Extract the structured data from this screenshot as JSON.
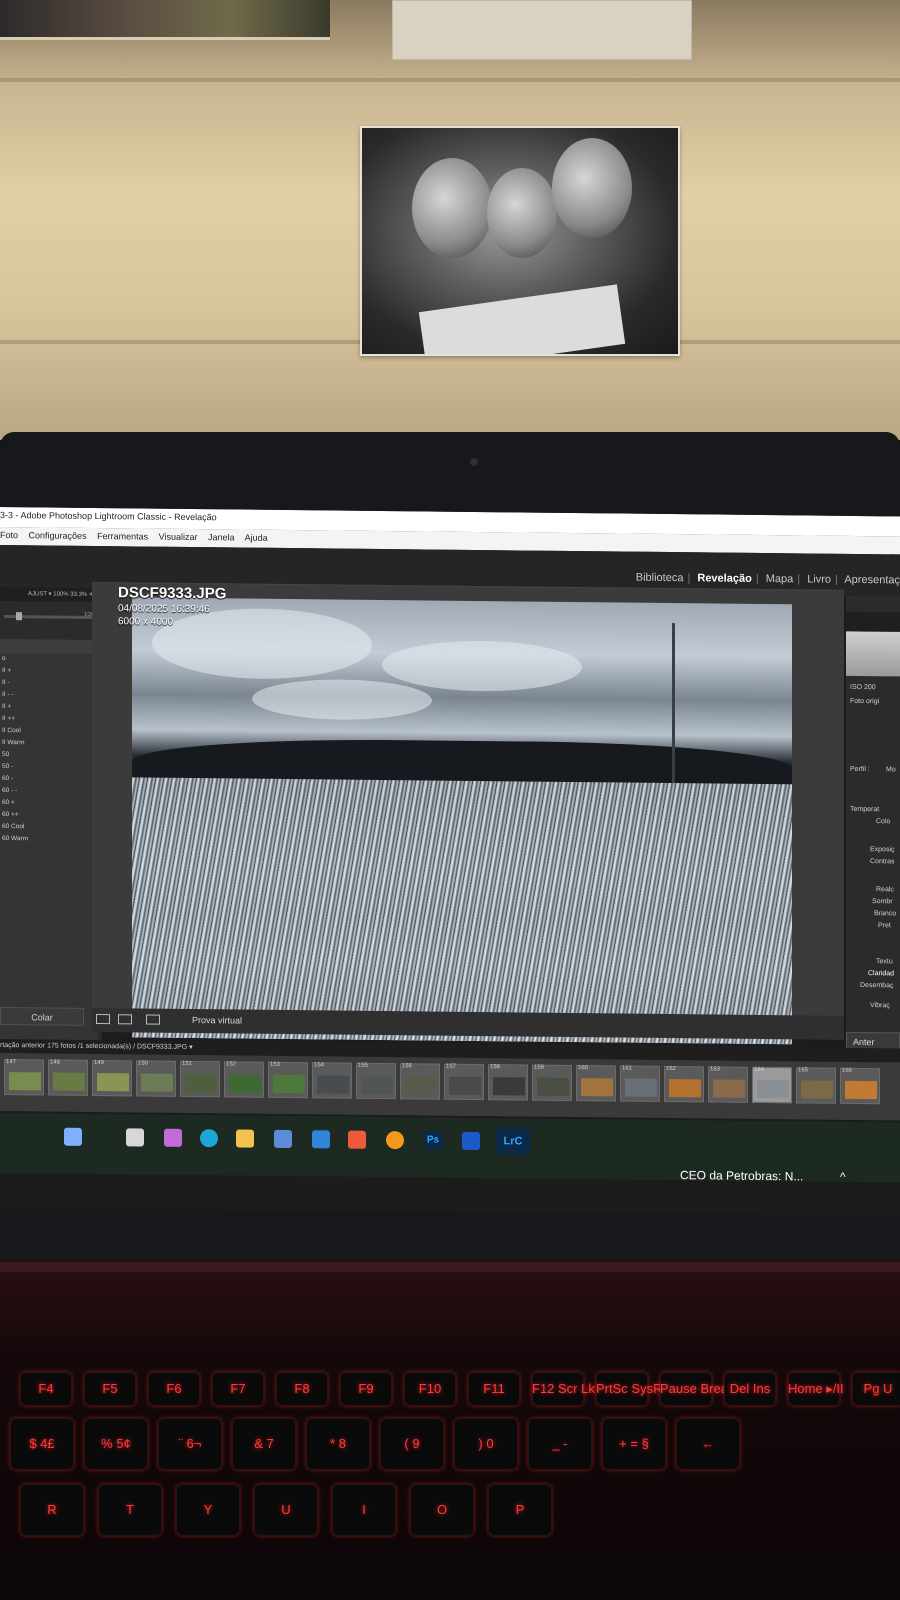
{
  "window": {
    "title": "3-3 - Adobe Photoshop Lightroom Classic - Revelação"
  },
  "menu": [
    "Foto",
    "Configurações",
    "Ferramentas",
    "Visualizar",
    "Janela",
    "Ajuda"
  ],
  "modules": {
    "items": [
      "Biblioteca",
      "Revelação",
      "Mapa",
      "Livro",
      "Apresentaç"
    ],
    "active": "Revelação"
  },
  "left_panel": {
    "top_label": "AJUST ▾  100%  33.3% ≑",
    "slider_value": "100",
    "presets": [
      "o",
      "II +",
      "II -",
      "II - -",
      "II +",
      "II ++",
      "II Cool",
      "II Warm",
      "50",
      "50 -",
      "60 -",
      "60 - -",
      "60 +",
      "60 ++",
      "60 Cool",
      "60 Warm"
    ],
    "colar_label": "Colar"
  },
  "photo": {
    "filename": "DSCF9333.JPG",
    "datetime": "04/08/2025 16:39:46",
    "dimensions": "6000 x 4000"
  },
  "photo_toolbar": {
    "prova_label": "Prova virtual"
  },
  "right_panel": {
    "iso": "ISO 200",
    "foto_orig": "Foto origi",
    "perfil_label": "Perfil :",
    "perfil_value": "Mo",
    "rows": [
      "Temperat",
      "Colo",
      "Exposiç",
      "Contras",
      "Realc",
      "Sombr",
      "Branco",
      "Pret",
      "Textu",
      "Claridad",
      "Desembaç",
      "Vibraç"
    ],
    "anterior_label": "Anter"
  },
  "filmstrip": {
    "nav_text": "rtação anterior   175 fotos /1 selecionada(s) / DSCF9333.JPG ▾",
    "thumb_numbers": [
      "147",
      "148",
      "149",
      "150",
      "151",
      "152",
      "153",
      "154",
      "155",
      "156",
      "157",
      "158",
      "159",
      "160",
      "161",
      "162",
      "163",
      "164",
      "165",
      "166"
    ],
    "selected_number": "164"
  },
  "taskbar": {
    "apps": [
      "Copilot",
      "Task View",
      "Microsoft 365",
      "Edge",
      "File Explorer",
      "Store",
      "Mail",
      "Brave",
      "Audible",
      "Ps",
      "Prime",
      "LrC"
    ],
    "news": "CEO da Petrobras: N...",
    "tray": "^"
  },
  "keyboard": {
    "fn_row": [
      "F4",
      "F5",
      "F6",
      "F7",
      "F8",
      "F9",
      "F10",
      "F11",
      "F12 Scr Lk",
      "PrtSc SysRq",
      "Pause Break",
      "Del Ins",
      "Home ▸/II",
      "Pg U"
    ],
    "num_row": [
      "$ 4£",
      "% 5¢",
      "¨ 6¬",
      "& 7",
      "* 8",
      "( 9",
      ") 0",
      "_ -",
      "+ = §",
      "←"
    ],
    "letter_row": [
      "R",
      "T",
      "Y",
      "U",
      "I",
      "O",
      "P"
    ]
  },
  "colors": {
    "lr_panel": "#2b2b2b",
    "lr_dark": "#1c1c1c",
    "keyboard_glow": "#ff3b3b",
    "taskbar": "#1d2a22"
  }
}
